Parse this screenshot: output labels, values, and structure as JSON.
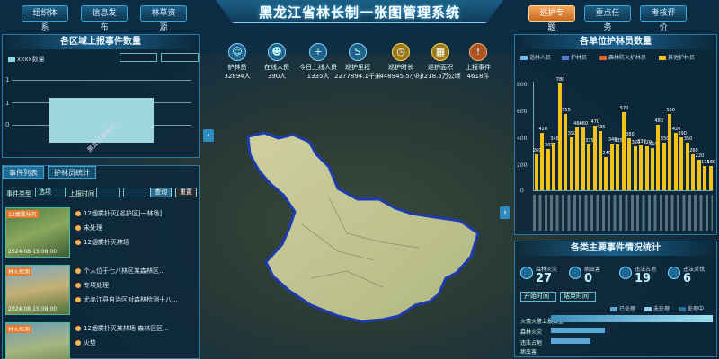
{
  "header": {
    "title": "黑龙江省林长制一张图管理系统",
    "left_buttons": [
      {
        "label": "组织体系"
      },
      {
        "label": "信息发布"
      },
      {
        "label": "林草资源"
      }
    ],
    "right_buttons": [
      {
        "label": "巡护专题",
        "active": true
      },
      {
        "label": "重点任务"
      },
      {
        "label": "考核评价"
      }
    ]
  },
  "left_chart_panel": {
    "title": "各区域上报事件数量",
    "legend": "xxxx数量",
    "y_ticks": [
      "1",
      "1",
      "0"
    ],
    "chart_data": {
      "type": "bar",
      "categories": [
        "黑龙江省林区"
      ],
      "values": [
        1
      ]
    }
  },
  "left_list_panel": {
    "tabs": [
      {
        "label": "事件列表",
        "active": true
      },
      {
        "label": "护林员统计"
      }
    ],
    "filter": {
      "type_label": "事件类型",
      "type_value": "选项",
      "time_label": "上报时间",
      "btn_query": "查询",
      "btn_reset": "重置"
    },
    "items": [
      {
        "tag": "12烟雾扑灭",
        "date": "2024-08-15 08:00",
        "line1": "12烟雾扑灭[巡护区]一林场]",
        "line2": "未处理",
        "line3": "12烟雾扑灭林场"
      },
      {
        "tag": "林火检测",
        "date": "2024-08-15 08:00",
        "line1": "个人位于七八林区某森林区...",
        "line2": "专项处理",
        "line3": "尤赤江县自治区对森林检测十八..."
      },
      {
        "tag": "林火检测",
        "date": "",
        "line1": "12烟雾扑灭某林场 森林区区...",
        "line2": "",
        "line3": "火势"
      }
    ]
  },
  "stats": [
    {
      "icon": "person-icon",
      "label": "护林员",
      "value": "32894人",
      "style": "blue"
    },
    {
      "icon": "people-icon",
      "label": "在线人员",
      "value": "390人",
      "style": "blue"
    },
    {
      "icon": "person-plus-icon",
      "label": "今日上线人员",
      "value": "1335人",
      "style": "blue"
    },
    {
      "icon": "route-icon",
      "label": "巡护里程",
      "value": "2277894.1千米",
      "style": "blue"
    },
    {
      "icon": "clock-icon",
      "label": "巡护时长",
      "value": "448945.5小时",
      "style": "gold"
    },
    {
      "icon": "area-icon",
      "label": "巡护面积",
      "value": "3218.5万公顷",
      "style": "gold"
    },
    {
      "icon": "report-icon",
      "label": "上报事件",
      "value": "4618件",
      "style": "orange"
    }
  ],
  "right_chart_panel": {
    "title": "各单位护林员数量",
    "legend": [
      {
        "label": "巡林人员",
        "color": "#6fb8f0"
      },
      {
        "label": "护林员",
        "color": "#4f7bd0"
      },
      {
        "label": "森林防火护林员",
        "color": "#e8622a"
      },
      {
        "label": "其他护林员",
        "color": "#f2c21a"
      }
    ],
    "y_ticks": [
      "800",
      "600",
      "400",
      "200",
      "0"
    ],
    "chart_data": {
      "type": "bar",
      "ylim": [
        0,
        800
      ],
      "values": [
        260,
        420,
        305,
        348,
        780,
        555,
        390,
        460,
        460,
        335,
        470,
        435,
        240,
        340,
        335,
        570,
        380,
        320,
        330,
        320,
        310,
        480,
        350,
        560,
        420,
        390,
        350,
        260,
        220,
        175,
        180
      ]
    }
  },
  "event_panel": {
    "title": "各类主要事件情况统计",
    "items": [
      {
        "label": "森林火灾",
        "value": "27"
      },
      {
        "label": "病虫害",
        "value": "0"
      },
      {
        "label": "违法占地",
        "value": "19"
      },
      {
        "label": "违法采伐",
        "value": "6"
      }
    ],
    "selects": [
      "开始时间",
      "结束时间"
    ],
    "mini_legend": [
      "已处理",
      "未处理",
      "处理中"
    ],
    "row_labels": [
      "火情火警上报数量",
      "森林火灾",
      "违法占地",
      "病虫害"
    ]
  }
}
